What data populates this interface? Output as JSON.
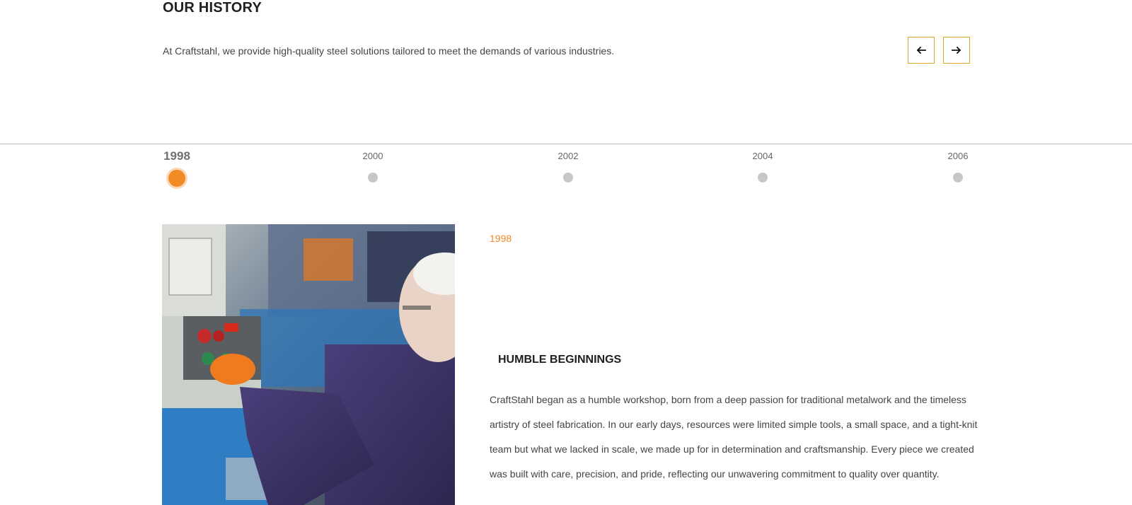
{
  "section": {
    "title": "OUR HISTORY",
    "intro": "At Craftstahl, we provide high-quality steel solutions tailored to meet the demands of various industries."
  },
  "navigation": {
    "prev_icon": "arrow-left-icon",
    "next_icon": "arrow-right-icon",
    "accent_color": "#e0a52a"
  },
  "timeline": {
    "active_color": "#f28a26",
    "inactive_color": "#c7c7c7",
    "items": [
      {
        "year": "1998",
        "active": true
      },
      {
        "year": "2000",
        "active": false
      },
      {
        "year": "2002",
        "active": false
      },
      {
        "year": "2004",
        "active": false
      },
      {
        "year": "2006",
        "active": false
      }
    ]
  },
  "detail": {
    "year": "1998",
    "heading": "HUMBLE BEGINNINGS",
    "body": "CraftStahl began as a humble workshop, born from a deep passion for traditional metalwork and the timeless artistry of steel fabrication. In our early days, resources were limited simple tools, a small space, and a tight-knit team but what we lacked in scale, we made up for in determination and craftsmanship. Every piece we created was built with care, precision, and pride, reflecting our unwavering commitment to quality over quantity."
  }
}
